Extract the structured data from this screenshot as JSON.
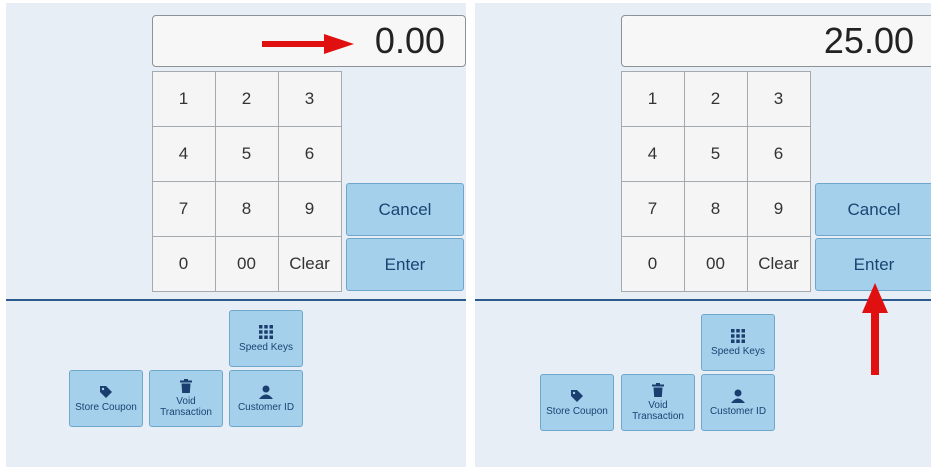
{
  "left_screen": {
    "display_value": "0.00",
    "keys": [
      "1",
      "2",
      "3",
      "4",
      "5",
      "6",
      "7",
      "8",
      "9",
      "0",
      "00",
      "Clear"
    ],
    "cancel_label": "Cancel",
    "enter_label": "Enter",
    "functions": {
      "speed_keys": "Speed Keys",
      "store_coupon": "Store Coupon",
      "void_transaction": "Void Transaction",
      "customer_id": "Customer ID"
    }
  },
  "right_screen": {
    "display_value": "25.00",
    "keys": [
      "1",
      "2",
      "3",
      "4",
      "5",
      "6",
      "7",
      "8",
      "9",
      "0",
      "00",
      "Clear"
    ],
    "cancel_label": "Cancel",
    "enter_label": "Enter",
    "functions": {
      "speed_keys": "Speed Keys",
      "store_coupon": "Store Coupon",
      "void_transaction": "Void Transaction",
      "customer_id": "Customer ID"
    }
  },
  "colors": {
    "action_button": "#a4d0ec",
    "action_text": "#1a4472",
    "divider": "#2d5a8e",
    "annotation_arrow": "#e01010"
  },
  "icons": {
    "speed_keys": "grid-icon",
    "store_coupon": "tag-icon",
    "void_transaction": "trash-icon",
    "customer_id": "user-icon",
    "annotations": [
      "arrow-right-icon",
      "arrow-up-icon"
    ]
  }
}
